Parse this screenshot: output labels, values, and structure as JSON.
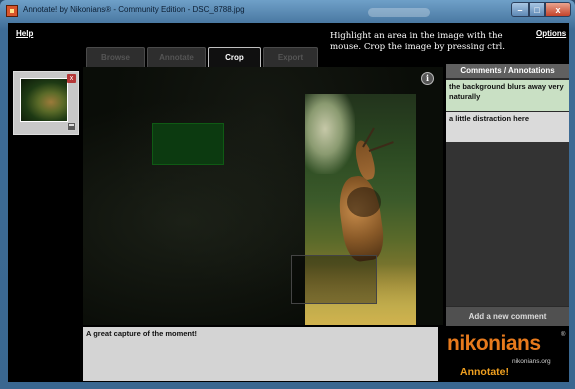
{
  "window": {
    "title": "Annotate! by Nikonians® - Community Edition - DSC_8788.jpg",
    "buttons": {
      "minimize": "–",
      "maximize": "□",
      "close": "x"
    }
  },
  "menu": {
    "help": "Help",
    "options": "Options"
  },
  "instruction": "Highlight an area in the image with the mouse. Crop the image by pressing ctrl.",
  "tabs": [
    {
      "label": "Browse",
      "active": false
    },
    {
      "label": "Annotate",
      "active": false
    },
    {
      "label": "Crop",
      "active": true
    },
    {
      "label": "Export",
      "active": false
    }
  ],
  "thumbnail": {
    "remove_icon": "close-icon",
    "save_icon": "disk-icon",
    "remove_glyph": "x"
  },
  "viewer": {
    "info_icon": "info-icon",
    "info_glyph": "i"
  },
  "comments": {
    "header": "Comments / Annotations",
    "items": [
      "the background blurs away very naturally",
      "a little distraction here"
    ],
    "add_label": "Add a new comment"
  },
  "caption": "A great capture of the moment!",
  "logo": {
    "name": "nikonians",
    "registered": "®",
    "domain": "nikonians.org",
    "tagline": "Annotate!"
  },
  "colors": {
    "accent_orange": "#e87a1c",
    "selected_comment": "#c9e0c4",
    "selection_green": "#0c3a10"
  }
}
